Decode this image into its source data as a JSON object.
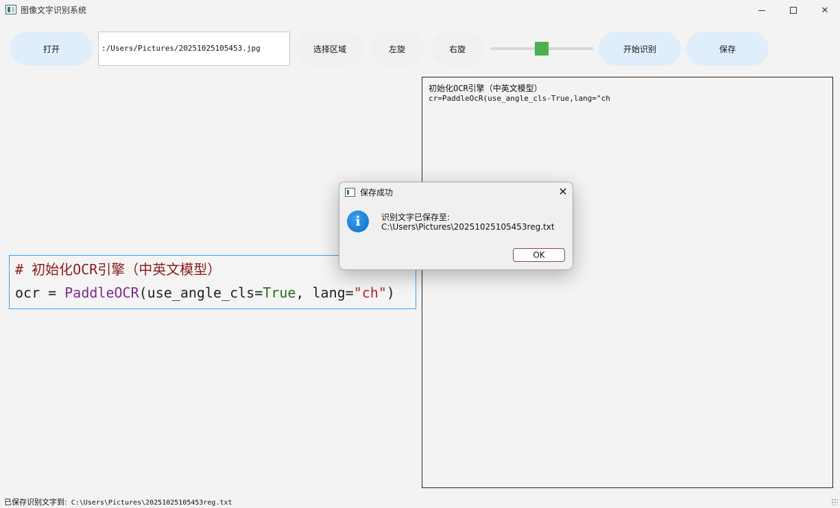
{
  "window": {
    "title": "图像文字识别系统",
    "minimize_icon": "minimize-icon",
    "maximize_icon": "maximize-icon",
    "close_icon": "close-icon",
    "close_glyph": "✕"
  },
  "toolbar": {
    "open_label": "打开",
    "path_value": ":/Users/Pictures/20251025105453.jpg",
    "select_region_label": "选择区域",
    "rotate_left_label": "左旋",
    "rotate_right_label": "右旋",
    "start_label": "开始识别",
    "save_label": "保存",
    "slider_level": 0.5,
    "accent_color": "#4caf50"
  },
  "image": {
    "line1": "# 初始化OCR引擎（中英文模型）",
    "line2": {
      "var": "ocr",
      "op": " = ",
      "fn": "PaddleOCR",
      "open": "(use_angle_cls=",
      "kw": "True",
      "mid": ", lang=",
      "str": "\"ch\"",
      "close": ")"
    }
  },
  "result": {
    "line1": "初始化OCR引擎（中英文模型）",
    "line2": "cr=PaddleOcR(use_angle_cls-True,lang=\"ch"
  },
  "dialog": {
    "title": "保存成功",
    "message": "识别文字已保存至:",
    "path": "C:\\Users\\Pictures\\20251025105453reg.txt",
    "ok_label": "OK",
    "close_glyph": "✕",
    "info_glyph": "i"
  },
  "status": {
    "prefix": "已保存识别文字到:",
    "path": " C:\\Users\\Pictures\\20251025105453reg.txt"
  }
}
